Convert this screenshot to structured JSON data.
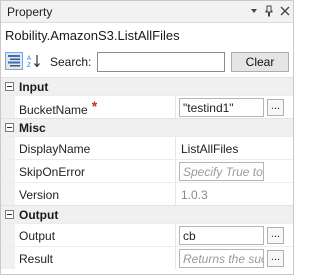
{
  "window": {
    "title": "Property"
  },
  "header": {
    "type_name": "Robility.AmazonS3.ListAllFiles"
  },
  "toolbar": {
    "search_label": "Search:",
    "search_value": "",
    "clear_label": "Clear",
    "categorized_icon": "categorized-icon",
    "alphabetical_icon": "alphabetical-icon"
  },
  "categories": {
    "input": {
      "label": "Input",
      "bucket_name": {
        "label": "BucketName",
        "required_marker": "*",
        "value": "\"testind1\""
      }
    },
    "misc": {
      "label": "Misc",
      "display_name": {
        "label": "DisplayName",
        "value": "ListAllFiles"
      },
      "skip_on_error": {
        "label": "SkipOnError",
        "placeholder": "Specify True to ..."
      },
      "version": {
        "label": "Version",
        "value": "1.0.3"
      }
    },
    "output": {
      "label": "Output",
      "output": {
        "label": "Output",
        "value": "cb"
      },
      "result": {
        "label": "Result",
        "placeholder": "Returns the succ"
      }
    }
  },
  "ellipsis_label": "...",
  "colors": {
    "required": "#e02020",
    "selected_toggle": "#dce8f6"
  }
}
